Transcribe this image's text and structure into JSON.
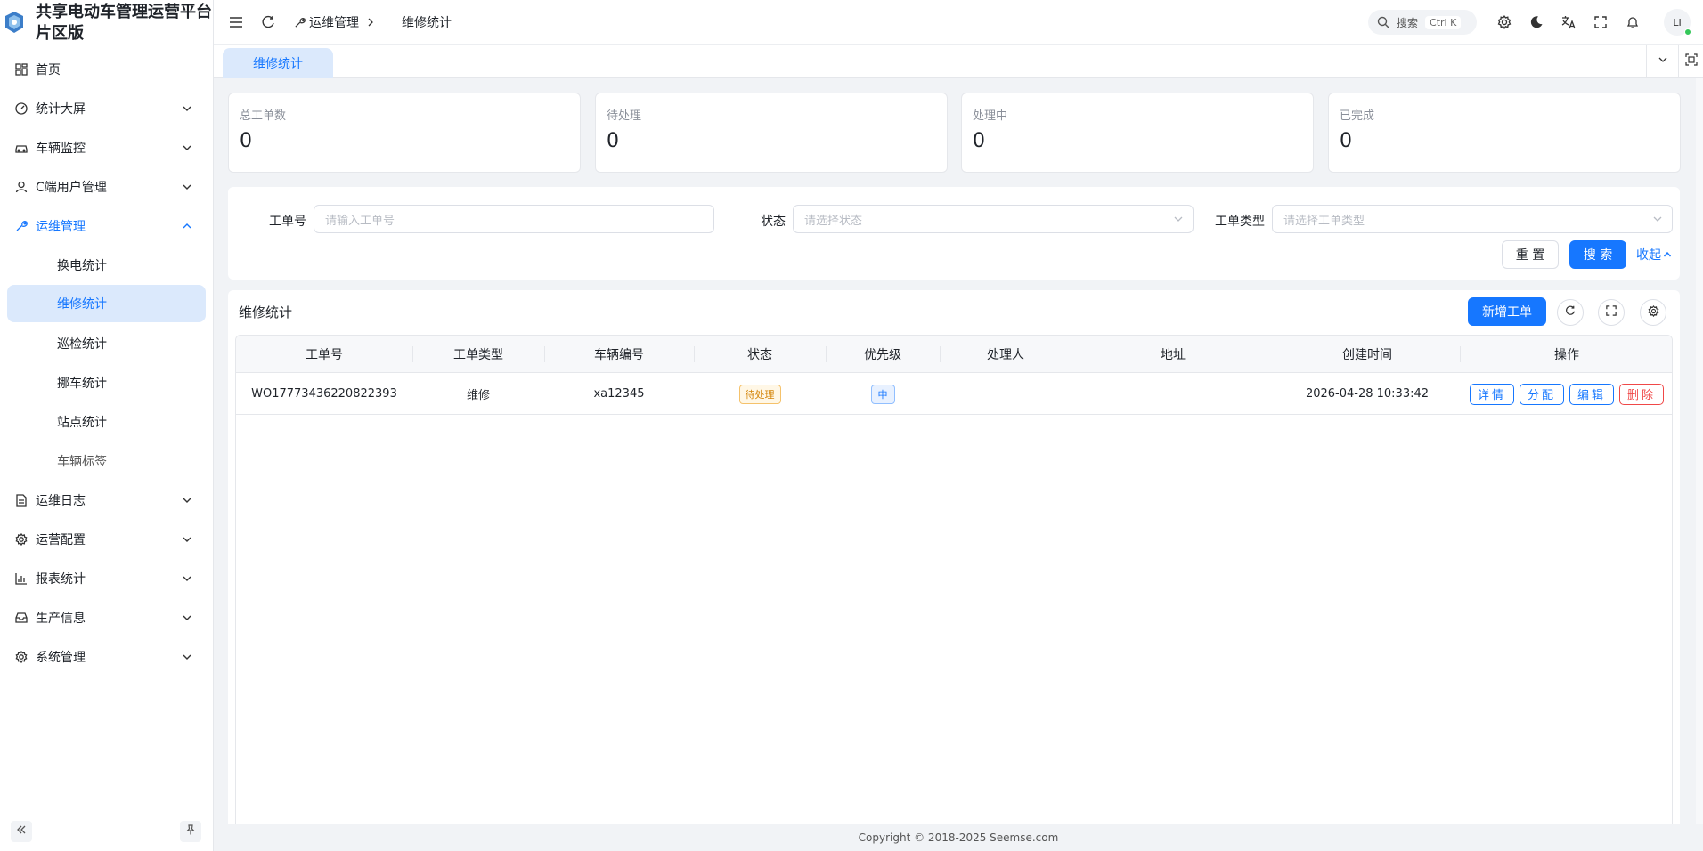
{
  "brand": {
    "title_line1": "共享电动车管理运营平台",
    "title_line2": "片区版",
    "logo_icon": "shield-logo-icon",
    "accent": "#1677ff"
  },
  "sidebar": {
    "items": [
      {
        "label": "首页",
        "icon": "grid-icon"
      },
      {
        "label": "统计大屏",
        "icon": "gauge-icon"
      },
      {
        "label": "车辆监控",
        "icon": "car-icon"
      },
      {
        "label": "C端用户管理",
        "icon": "user-icon"
      },
      {
        "label": "运维管理",
        "icon": "wrench-icon"
      }
    ],
    "sub_items": [
      {
        "label": "换电统计"
      },
      {
        "label": "维修统计"
      },
      {
        "label": "巡检统计"
      },
      {
        "label": "挪车统计"
      },
      {
        "label": "站点统计"
      },
      {
        "label": "车辆标签"
      }
    ],
    "items_after": [
      {
        "label": "运维日志",
        "icon": "doc-icon"
      },
      {
        "label": "运营配置",
        "icon": "gear-icon"
      },
      {
        "label": "报表统计",
        "icon": "bar-chart-icon"
      },
      {
        "label": "生产信息",
        "icon": "inbox-icon"
      },
      {
        "label": "系统管理",
        "icon": "gear-icon"
      }
    ]
  },
  "header": {
    "breadcrumb_parent": "运维管理",
    "breadcrumb_current": "维修统计",
    "search_label": "搜索",
    "search_shortcut": "Ctrl K",
    "avatar_text": "LI"
  },
  "tabs": [
    {
      "label": "维修统计"
    }
  ],
  "stats": [
    {
      "label": "总工单数",
      "value": "0"
    },
    {
      "label": "待处理",
      "value": "0"
    },
    {
      "label": "处理中",
      "value": "0"
    },
    {
      "label": "已完成",
      "value": "0"
    }
  ],
  "filter": {
    "order_no_label": "工单号",
    "order_no_placeholder": "请输入工单号",
    "status_label": "状态",
    "status_placeholder": "请选择状态",
    "type_label": "工单类型",
    "type_placeholder": "请选择工单类型",
    "reset_label": "重 置",
    "search_label": "搜 索",
    "collapse_label": "收起"
  },
  "table": {
    "title": "维修统计",
    "add_label": "新增工单",
    "columns": [
      "工单号",
      "工单类型",
      "车辆编号",
      "状态",
      "优先级",
      "处理人",
      "地址",
      "创建时间",
      "操作"
    ],
    "rows": [
      {
        "order_no": "WO17773436220822393",
        "type": "维修",
        "vehicle_no": "xa12345",
        "status": "待处理",
        "priority": "中",
        "handler": "",
        "address": "",
        "created_at": "2026-04-28 10:33:42",
        "actions": [
          "详情",
          "分配",
          "编辑",
          "删除"
        ]
      }
    ]
  },
  "footer": {
    "copyright": "Copyright © 2018-2025 Seemse.com"
  }
}
